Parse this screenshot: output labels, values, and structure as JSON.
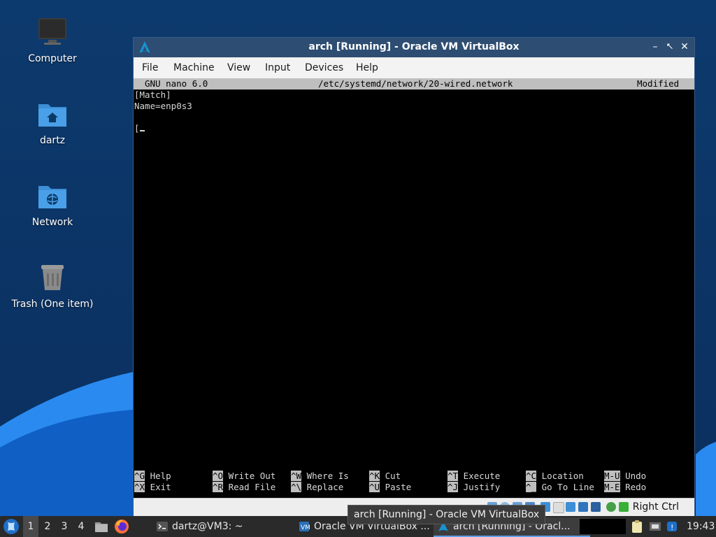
{
  "desktop": {
    "icons": [
      {
        "label": "Computer",
        "icon": "computer-icon"
      },
      {
        "label": "dartz",
        "icon": "home-folder-icon"
      },
      {
        "label": "Network",
        "icon": "network-folder-icon"
      },
      {
        "label": "Trash (One item)",
        "icon": "trash-icon"
      }
    ]
  },
  "window": {
    "title": "arch [Running] - Oracle VM VirtualBox",
    "menu": [
      "File",
      "Machine",
      "View",
      "Input",
      "Devices",
      "Help"
    ],
    "controls": {
      "minimize": "–",
      "maximize": "⭦",
      "close": "✕"
    }
  },
  "nano": {
    "version": "GNU nano 6.0",
    "filename": "/etc/systemd/network/20-wired.network",
    "status": "Modified",
    "lines": [
      "[Match]",
      "Name=enp0s3",
      "",
      "["
    ],
    "shortcuts_row1": [
      {
        "key": "^G",
        "label": "Help"
      },
      {
        "key": "^O",
        "label": "Write Out"
      },
      {
        "key": "^W",
        "label": "Where Is"
      },
      {
        "key": "^K",
        "label": "Cut"
      },
      {
        "key": "^T",
        "label": "Execute"
      },
      {
        "key": "^C",
        "label": "Location"
      },
      {
        "key": "M-U",
        "label": "Undo"
      }
    ],
    "shortcuts_row2": [
      {
        "key": "^X",
        "label": "Exit"
      },
      {
        "key": "^R",
        "label": "Read File"
      },
      {
        "key": "^\\",
        "label": "Replace"
      },
      {
        "key": "^U",
        "label": "Paste"
      },
      {
        "key": "^J",
        "label": "Justify"
      },
      {
        "key": "^_",
        "label": "Go To Line"
      },
      {
        "key": "M-E",
        "label": "Redo"
      }
    ]
  },
  "statusbar": {
    "host_key": "Right Ctrl"
  },
  "tooltip": {
    "text": "arch [Running] - Oracle VM VirtualBox"
  },
  "taskbar": {
    "workspaces": [
      "1",
      "2",
      "3",
      "4"
    ],
    "tasks": [
      {
        "label": "dartz@VM3: ~",
        "icon": "terminal-icon"
      },
      {
        "label": "Oracle VM VirtualBox ...",
        "icon": "virtualbox-icon"
      },
      {
        "label": "arch [Running] - Oracl...",
        "icon": "virtualbox-vm-icon"
      }
    ],
    "clock": "19:43"
  },
  "colors": {
    "desktop_bg": "#0b3c75",
    "window_title_bg": "#2d4d72",
    "nano_bar": "#bfbfbf",
    "taskbar_bg": "#2a2a2a"
  }
}
